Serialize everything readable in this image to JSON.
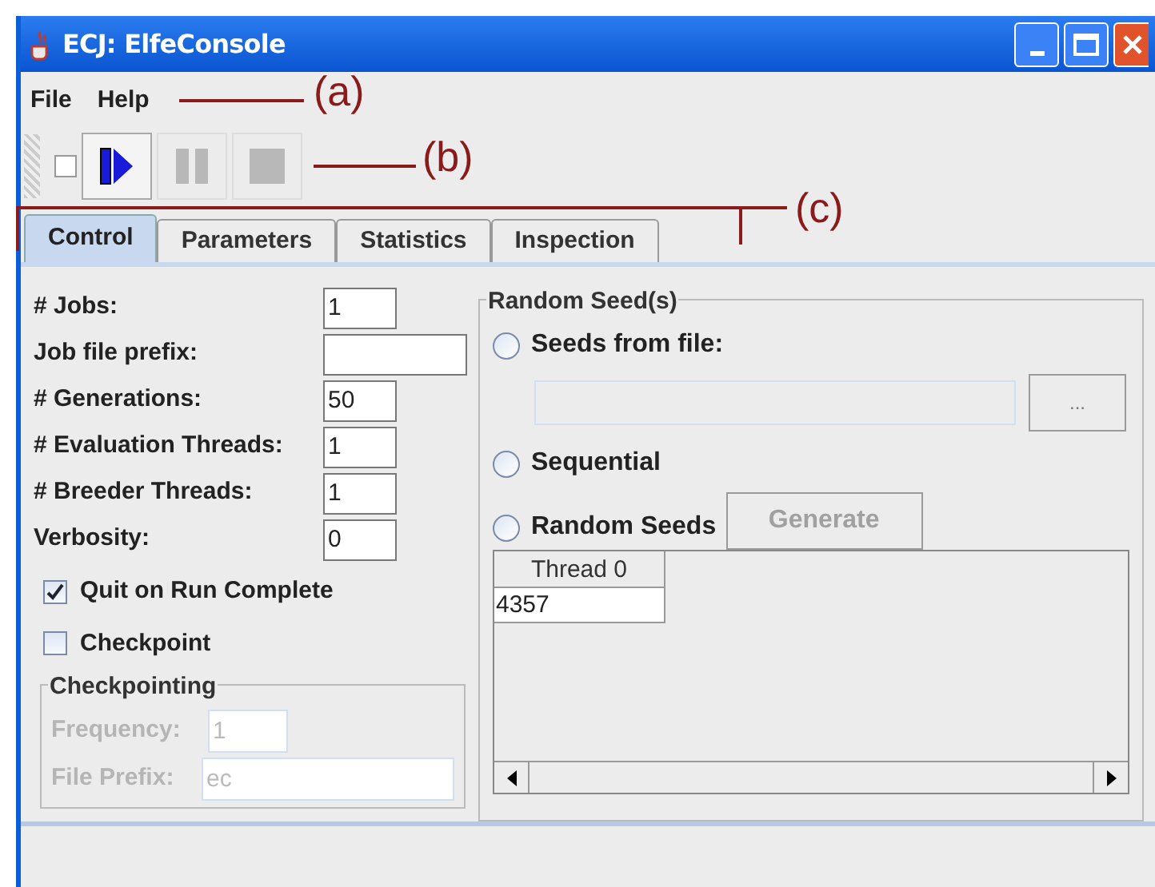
{
  "window": {
    "title": "ECJ: ElfeConsole"
  },
  "menu": [
    "File",
    "Help"
  ],
  "toolbar": {
    "checked": false,
    "buttons": [
      {
        "kind": "play",
        "disabled": false
      },
      {
        "kind": "pause",
        "disabled": true
      },
      {
        "kind": "stop",
        "disabled": true
      }
    ]
  },
  "tabs": [
    {
      "label": "Control",
      "selected": true
    },
    {
      "label": "Parameters",
      "selected": false
    },
    {
      "label": "Statistics",
      "selected": false
    },
    {
      "label": "Inspection",
      "selected": false
    }
  ],
  "fields": [
    {
      "label": "# Jobs:",
      "value": "1",
      "wide": false
    },
    {
      "label": "Job file prefix:",
      "wide": true
    },
    {
      "label": "# Generations:",
      "value": "50",
      "wide": false
    },
    {
      "label": "# Evaluation Threads:",
      "value": "1",
      "wide": false
    },
    {
      "label": "# Breeder Threads:",
      "value": "1",
      "wide": false
    },
    {
      "label": "Verbosity:",
      "value": "0",
      "wide": false
    }
  ],
  "checkboxes": [
    {
      "label": "Quit on Run Complete",
      "checked": true
    },
    {
      "label": "Checkpoint",
      "checked": false
    }
  ],
  "checkpointing": {
    "title": "Checkpointing",
    "disabled": true,
    "fields": [
      {
        "label": "Frequency:",
        "value": "1",
        "wide": false
      },
      {
        "label": "File Prefix:",
        "value": "ec",
        "wide": true
      }
    ]
  },
  "random_seeds": {
    "title": "Random Seed(s)",
    "options": [
      {
        "label": "Seeds from file:",
        "selected": false
      },
      {
        "label": "Sequential",
        "selected": false
      },
      {
        "label": "Random Seeds",
        "selected": false
      }
    ],
    "browse_button": "...",
    "generate_button": {
      "label": "Generate",
      "disabled": true
    },
    "table": {
      "columns": [
        "Thread 0"
      ],
      "rows": [
        [
          "4357"
        ]
      ]
    }
  },
  "annotations": [
    "(a)",
    "(b)",
    "(c)"
  ]
}
